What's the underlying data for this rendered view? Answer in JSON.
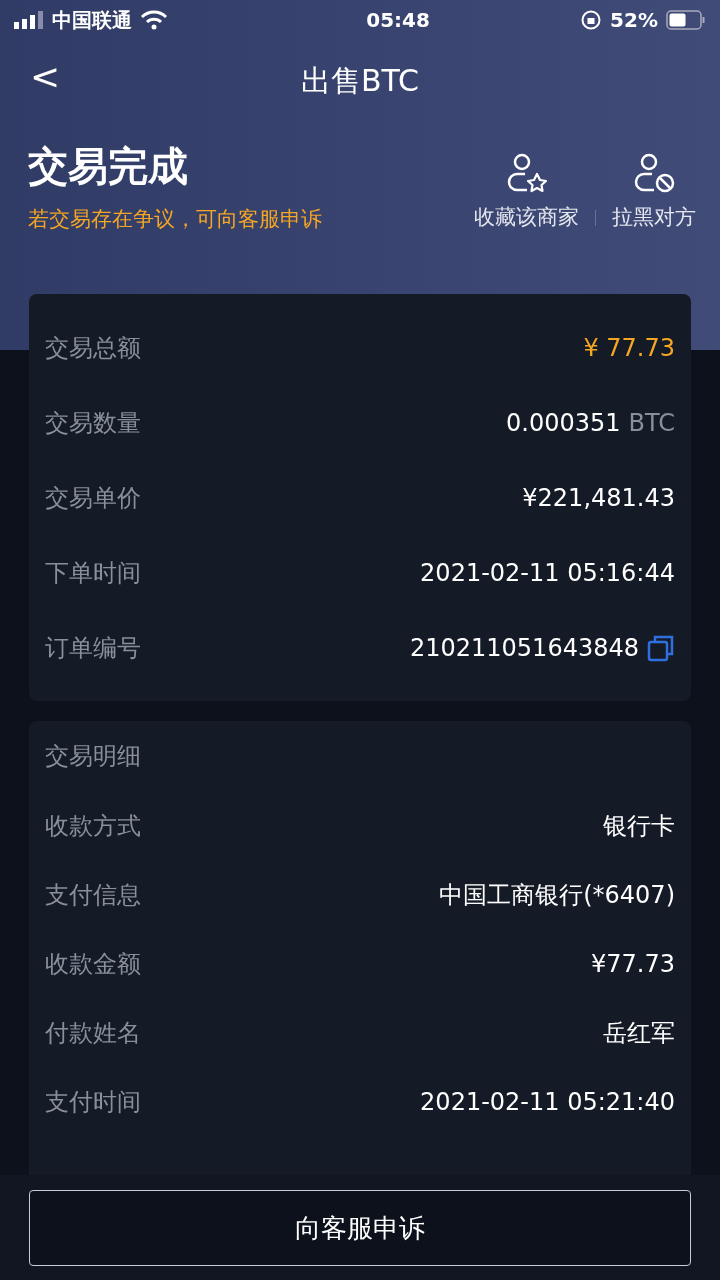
{
  "status_bar": {
    "carrier": "中国联通",
    "time": "05:48",
    "battery": "52%"
  },
  "nav": {
    "back": "<",
    "title": "出售BTC"
  },
  "header": {
    "status": "交易完成",
    "note": "若交易存在争议，可向客服申诉",
    "actions": [
      {
        "kind": "favorite",
        "label": "收藏该商家"
      },
      {
        "kind": "block",
        "label": "拉黑对方"
      }
    ]
  },
  "summary": [
    {
      "label": "交易总额",
      "value": "¥ 77.73",
      "kind": "highlight"
    },
    {
      "label": "交易数量",
      "value": "0.000351",
      "unit": "BTC",
      "kind": "plain"
    },
    {
      "label": "交易单价",
      "value": "¥221,481.43",
      "kind": "plain"
    },
    {
      "label": "下单时间",
      "value": "2021-02-11 05:16:44",
      "kind": "plain"
    },
    {
      "label": "订单编号",
      "value": "210211051643848",
      "kind": "copy"
    }
  ],
  "details": {
    "title": "交易明细",
    "rows": [
      {
        "label": "收款方式",
        "value": "银行卡"
      },
      {
        "label": "支付信息",
        "value": "中国工商银行(*6407)"
      },
      {
        "label": "收款金额",
        "value": "¥77.73"
      },
      {
        "label": "付款姓名",
        "value": "岳红军"
      },
      {
        "label": "支付时间",
        "value": "2021-02-11 05:21:40"
      }
    ]
  },
  "footer_button": "向客服申诉"
}
